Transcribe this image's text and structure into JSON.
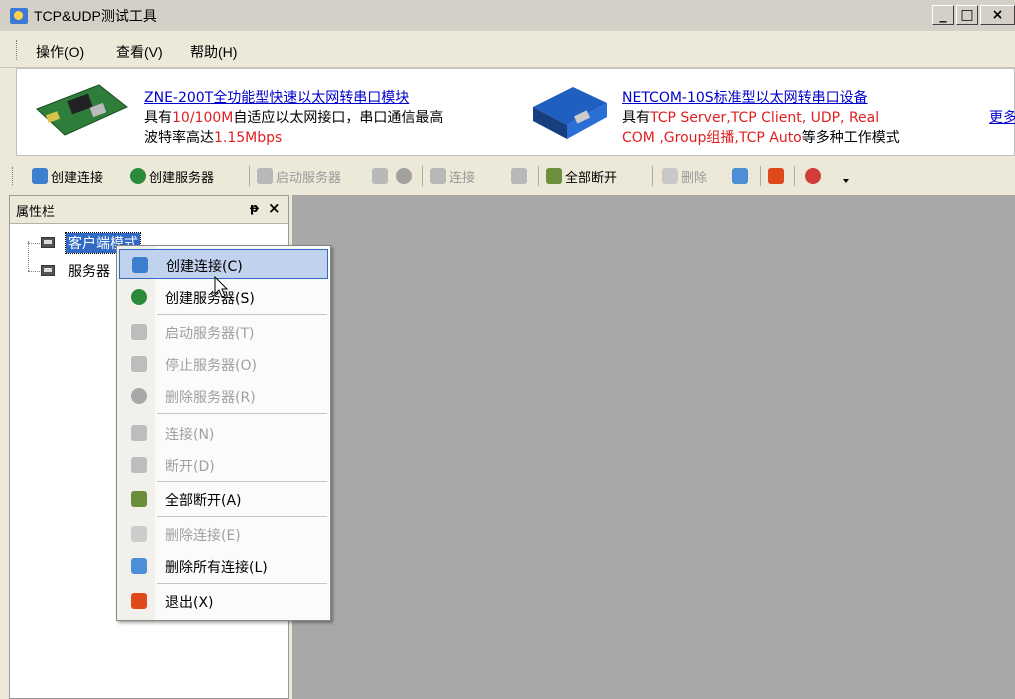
{
  "window": {
    "title": "TCP&UDP测试工具",
    "buttons": [
      "_",
      "□",
      "×"
    ]
  },
  "menubar": {
    "items": [
      "操作(O)",
      "查看(V)",
      "帮助(H)"
    ]
  },
  "ad": {
    "left": {
      "link": "ZNE-200T全功能型快速以太网转串口模块",
      "line1_prefix": "具有",
      "line1_highlight": "10/100M",
      "line1_suffix": "自适应以太网接口，串口通信最高",
      "line2_prefix": "波特率高达",
      "line2_highlight": "1.15Mbps"
    },
    "right": {
      "link": "NETCOM-10S标准型以太网转串口设备",
      "line1_prefix": "具有",
      "line1_highlight": "TCP Server,TCP Client, UDP, Real",
      "line2_highlight": "COM ,Group组播,TCP Auto",
      "line2_suffix": "等多种工作模式"
    },
    "more": "更多"
  },
  "toolbar": {
    "create_conn": "创建连接",
    "create_server": "创建服务器",
    "start_server": "启动服务器",
    "connect": "连接",
    "disconnect_all": "全部断开",
    "delete": "删除"
  },
  "panel": {
    "title": "属性栏",
    "pin": "ᵽ",
    "close": "×",
    "tree": [
      "客户端模式",
      "服务器"
    ]
  },
  "context_menu": {
    "items": [
      {
        "label": "创建连接(C)",
        "enabled": true,
        "icon": "create-connection-icon"
      },
      {
        "label": "创建服务器(S)",
        "enabled": true,
        "icon": "create-server-icon"
      },
      {
        "label": "启动服务器(T)",
        "enabled": false,
        "icon": "start-server-icon"
      },
      {
        "label": "停止服务器(O)",
        "enabled": false,
        "icon": "stop-server-icon"
      },
      {
        "label": "删除服务器(R)",
        "enabled": false,
        "icon": "delete-server-icon"
      },
      {
        "label": "连接(N)",
        "enabled": false,
        "icon": "connect-icon"
      },
      {
        "label": "断开(D)",
        "enabled": false,
        "icon": "disconnect-icon"
      },
      {
        "label": "全部断开(A)",
        "enabled": true,
        "icon": "disconnect-all-icon"
      },
      {
        "label": "删除连接(E)",
        "enabled": false,
        "icon": "delete-connection-icon"
      },
      {
        "label": "删除所有连接(L)",
        "enabled": true,
        "icon": "delete-all-connections-icon"
      },
      {
        "label": "退出(X)",
        "enabled": true,
        "icon": "exit-icon"
      }
    ]
  },
  "colors": {
    "selection": "#316ac5",
    "link": "#0000cc",
    "highlight_red": "#e02020",
    "workspace": "#a9a8a8"
  }
}
